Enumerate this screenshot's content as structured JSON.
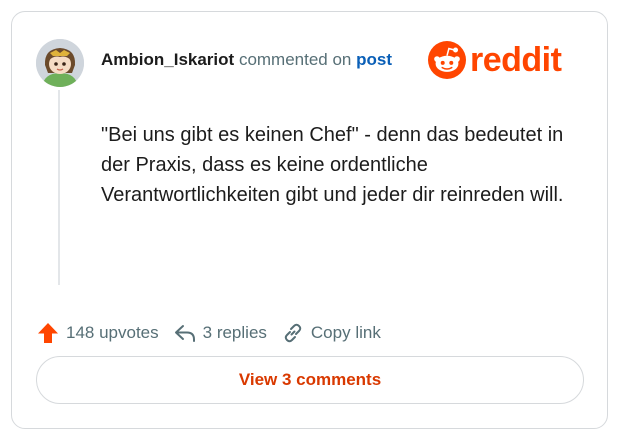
{
  "comment": {
    "author": "Ambion_Iskariot",
    "action_text": "commented on",
    "post_link_label": "post",
    "body": "\"Bei uns gibt es keinen Chef\" - denn das bedeutet in der Praxis, dass es keine ordentliche Verantwortlichkeiten gibt und jeder dir reinreden will."
  },
  "brand": {
    "name": "reddit",
    "color": "#ff4500"
  },
  "stats": {
    "upvotes_label": "148 upvotes",
    "replies_label": "3 replies",
    "copy_link_label": "Copy link"
  },
  "view_comments_label": "View 3 comments",
  "icons": {
    "upvote": "upvote-arrow-icon",
    "reply": "reply-arrow-icon",
    "link": "chain-link-icon",
    "logo": "reddit-snoo-icon"
  }
}
